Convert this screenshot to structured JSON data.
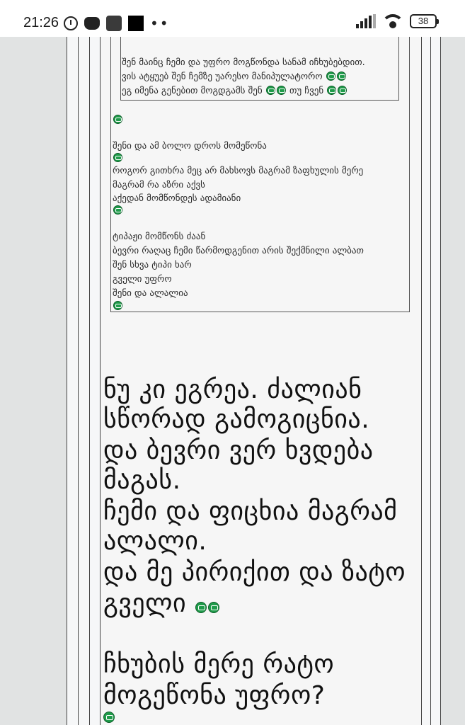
{
  "status_bar": {
    "time": "21:26",
    "battery": "38",
    "icons": [
      "alarm-icon",
      "discord-icon",
      "app-icon",
      "app-icon",
      "more-dots-icon",
      "signal-icon",
      "wifi-icon",
      "battery-icon"
    ]
  },
  "quote_nested": [
    "შენ მაინც ჩემი და უფრო მოგწონდა სანამ იჩხუბებდით.",
    "ვის ატყუებ შენ ჩემზე უარესო მანიპულატორო",
    "ეგ იმენა გენებით მოგდგამს შენ",
    "თუ ჩვენ"
  ],
  "quote_lines": [
    "შენი და ამ ბოლო დროს მომეწონა",
    "როგორ გითხრა მეც არ მახსოვს მაგრამ ზაფხულის მერე",
    "მაგრამ რა აზრი აქვს",
    "აქედან მომწონდეს ადამიანი",
    "ტიპაჟი მომწონს ძაან",
    "ბევრი რაღაც ჩემი წარმოდგენით არის შექმნილი ალბათ",
    "შენ სხვა ტიპი ხარ",
    "გველი უფრო",
    "შენი და ალალია"
  ],
  "reply_lines": [
    "ნუ კი ეგრეა. ძალიან",
    "სწორად გამოგიცნია.",
    "და ბევრი ვერ ხვდება",
    "მაგას.",
    "ჩემი და ფიცხია მაგრამ",
    "ალალი.",
    "და მე პირიქით და ზატო",
    "გველი",
    "ჩხუბის მერე რატო",
    "მოგეწონა უფრო?"
  ],
  "emoji_name": "grimacing-emoji"
}
